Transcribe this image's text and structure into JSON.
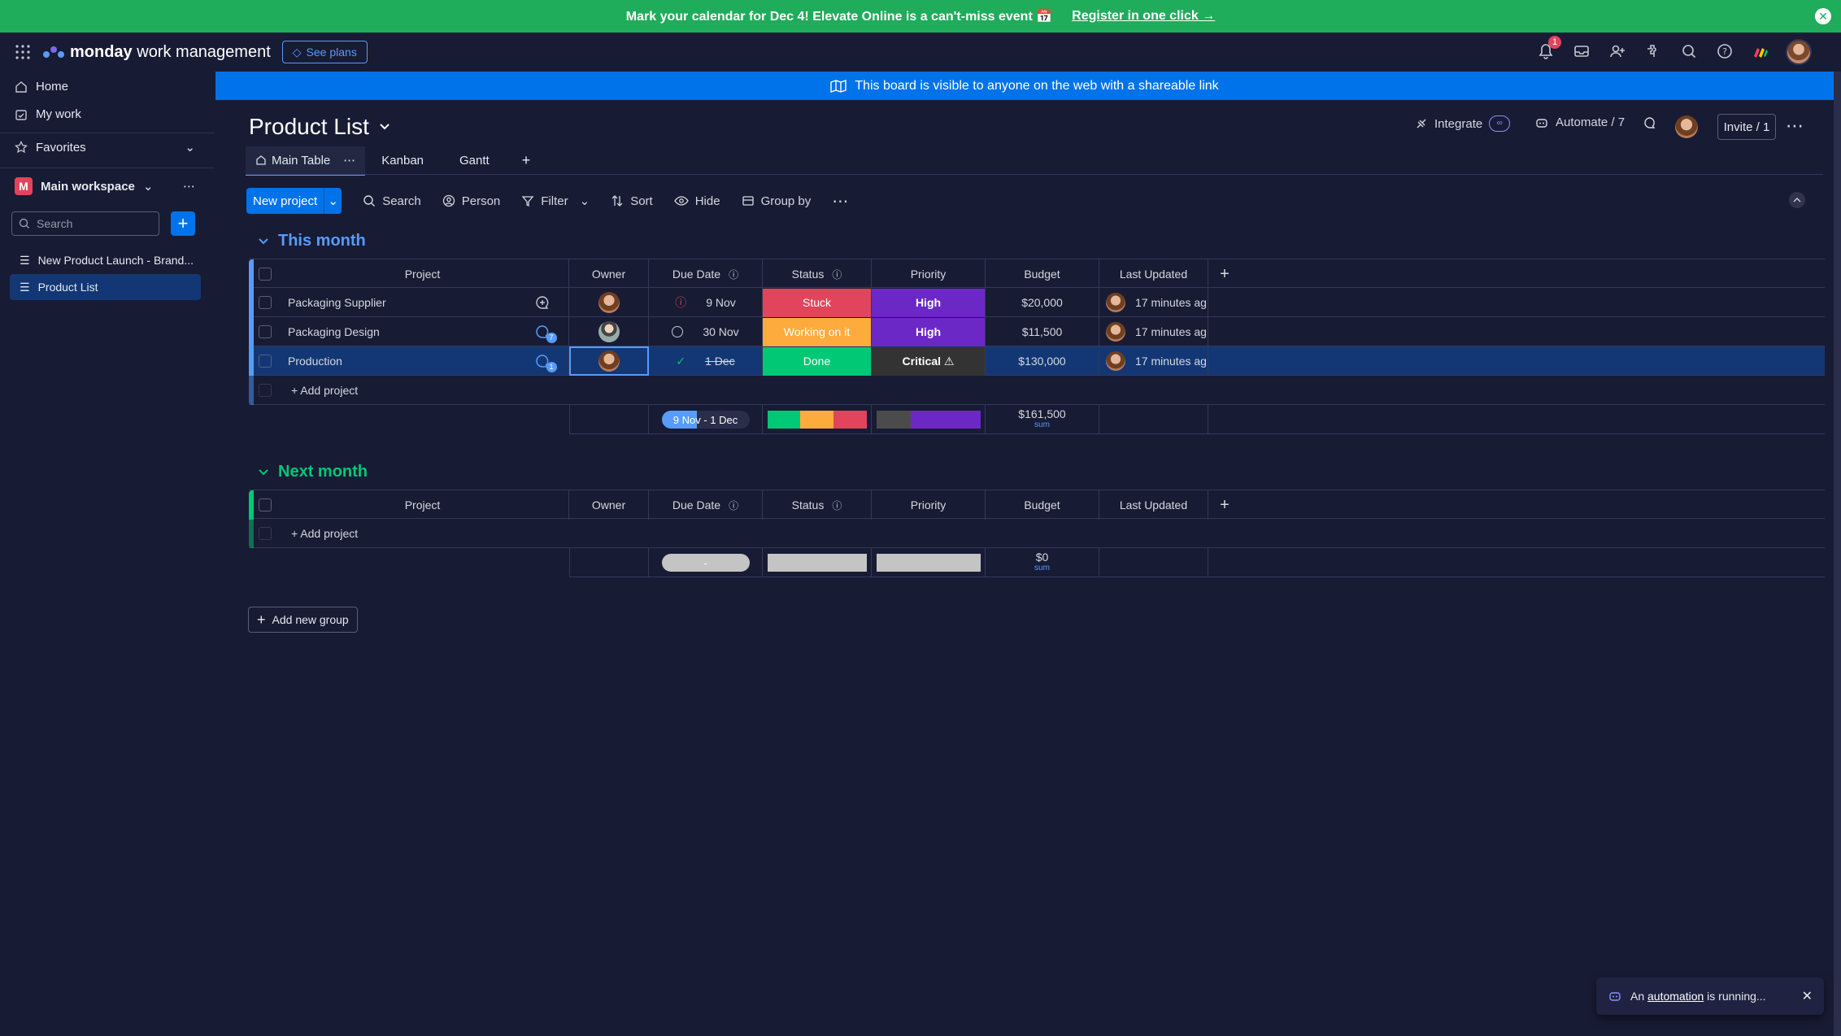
{
  "banner": {
    "message": "Mark your calendar for Dec 4! Elevate Online is a can't-miss event 📅",
    "cta": "Register in one click →"
  },
  "topnav": {
    "brand_bold": "monday",
    "brand_rest": " work management",
    "see_plans": "See plans",
    "notification_count": "1"
  },
  "sidebar": {
    "home": "Home",
    "my_work": "My work",
    "favorites": "Favorites",
    "workspace_initial": "M",
    "workspace": "Main workspace",
    "search_placeholder": "Search",
    "boards": [
      {
        "label": "New Product Launch - Brand..."
      },
      {
        "label": "Product List"
      }
    ]
  },
  "visibility": "This board is visible to anyone on the web with a shareable link",
  "board": {
    "title": "Product List",
    "integrate": "Integrate",
    "automate": "Automate / 7",
    "invite": "Invite / 1",
    "tabs": [
      "Main Table",
      "Kanban",
      "Gantt"
    ]
  },
  "toolbar": {
    "new_project": "New project",
    "search": "Search",
    "person": "Person",
    "filter": "Filter",
    "sort": "Sort",
    "hide": "Hide",
    "group_by": "Group by"
  },
  "columns": [
    "Project",
    "Owner",
    "Due Date",
    "Status",
    "Priority",
    "Budget",
    "Last Updated"
  ],
  "groups": [
    {
      "title": "This month",
      "color": "#579bfc",
      "rows": [
        {
          "project": "Packaging Supplier",
          "updates": "",
          "due": "9 Nov",
          "status": "Stuck",
          "status_color": "#e2445c",
          "priority": "High",
          "priority_color": "#6c28c6",
          "budget": "$20,000",
          "updated": "17 minutes ag"
        },
        {
          "project": "Packaging Design",
          "updates": "7",
          "due": "30 Nov",
          "status": "Working on it",
          "status_color": "#fdab3d",
          "priority": "High",
          "priority_color": "#6c28c6",
          "budget": "$11,500",
          "updated": "17 minutes ag"
        },
        {
          "project": "Production",
          "updates": "1",
          "due": "1 Dec",
          "status": "Done",
          "status_color": "#00c875",
          "priority": "Critical ⚠",
          "priority_color": "#333333",
          "budget": "$130,000",
          "updated": "17 minutes ag"
        }
      ],
      "add_label": "+ Add project",
      "summary": {
        "due": "9 Nov - 1 Dec",
        "budget": "$161,500",
        "budget_label": "sum"
      }
    },
    {
      "title": "Next month",
      "color": "#00c875",
      "rows": [],
      "add_label": "+ Add project",
      "summary": {
        "due": "-",
        "budget": "$0",
        "budget_label": "sum"
      }
    }
  ],
  "add_group": "Add new group",
  "toast": {
    "pre": "An ",
    "link": "automation",
    "post": " is running..."
  }
}
